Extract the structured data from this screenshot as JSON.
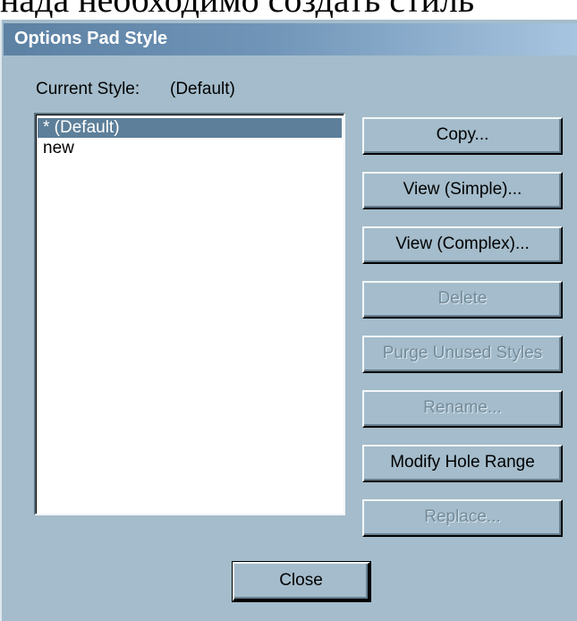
{
  "document_text": "нада необходимо создать стиль",
  "dialog": {
    "title": "Options Pad Style",
    "current_style_label": "Current Style:",
    "current_style_value": "(Default)"
  },
  "style_list": {
    "items": [
      {
        "label": "* (Default)",
        "selected": true
      },
      {
        "label": "new",
        "selected": false
      }
    ]
  },
  "buttons": {
    "copy": {
      "label": "Copy...",
      "enabled": true
    },
    "view_simple": {
      "label": "View (Simple)...",
      "enabled": true
    },
    "view_complex": {
      "label": "View (Complex)...",
      "enabled": true
    },
    "delete": {
      "label": "Delete",
      "enabled": false
    },
    "purge_unused": {
      "label": "Purge Unused Styles",
      "enabled": false
    },
    "rename": {
      "label": "Rename...",
      "enabled": false
    },
    "modify_hole_range": {
      "label": "Modify Hole Range",
      "enabled": true
    },
    "replace": {
      "label": "Replace...",
      "enabled": false
    },
    "close": {
      "label": "Close",
      "enabled": true
    }
  }
}
